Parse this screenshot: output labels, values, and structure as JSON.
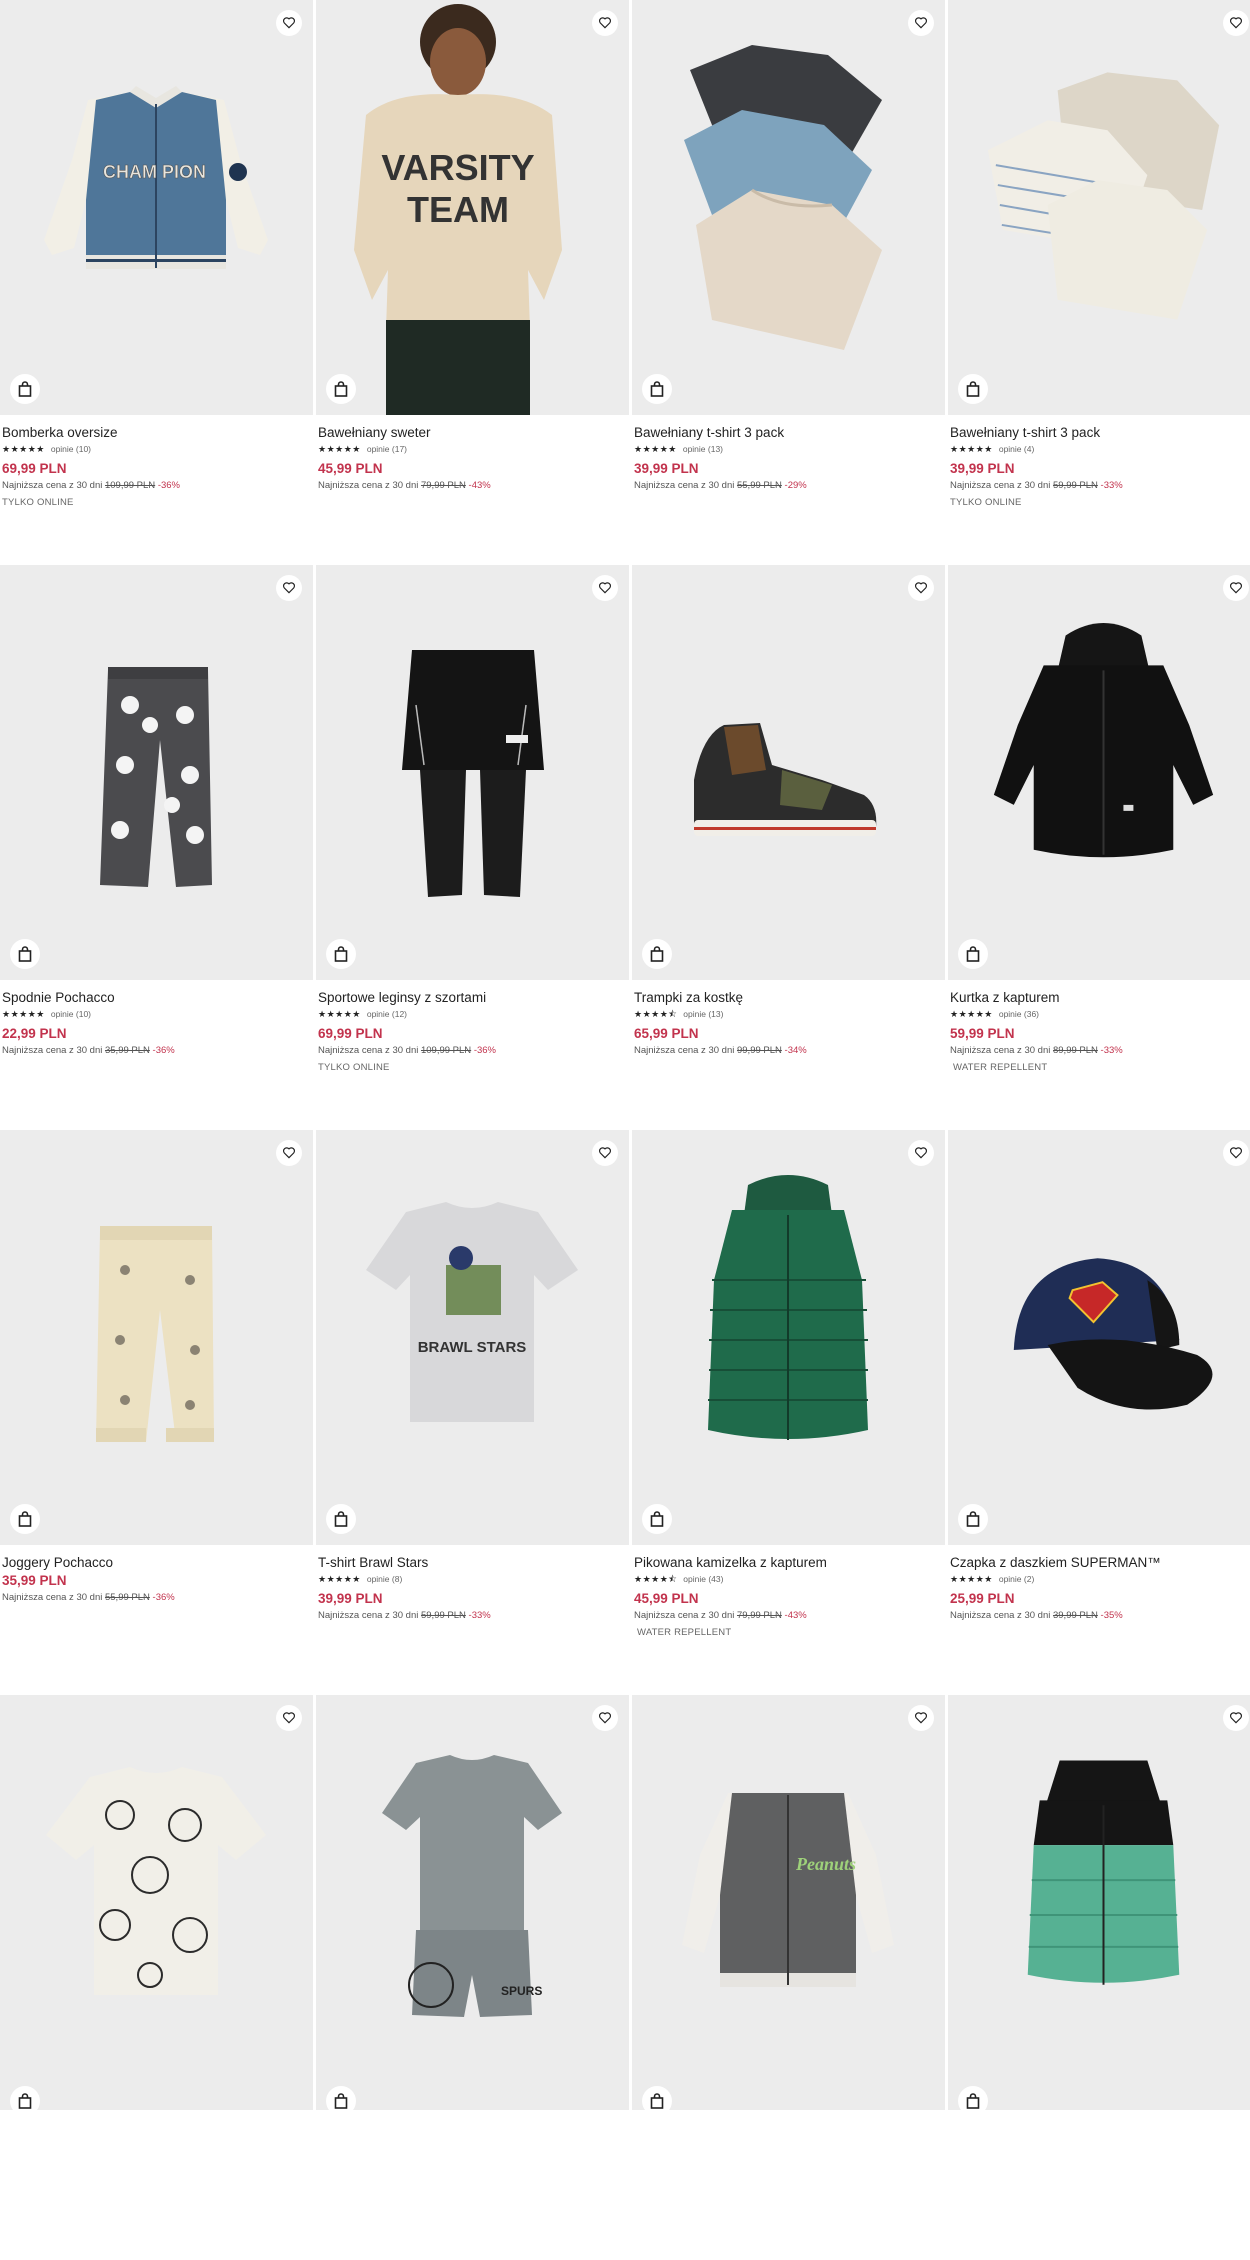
{
  "labels": {
    "wishlist": "♡",
    "cart": "bag"
  },
  "products": [
    {
      "name": "Bomberka oversize",
      "stars": "★★★★★",
      "reviews": "opinie (10)",
      "price": "69,99 PLN",
      "lowest_label": "Najniższa cena z 30 dni",
      "old_price": "109,99 PLN",
      "discount": "-36%",
      "tag": "TYLKO ONLINE"
    },
    {
      "name": "Bawełniany sweter",
      "stars": "★★★★★",
      "reviews": "opinie (17)",
      "price": "45,99 PLN",
      "lowest_label": "Najniższa cena z 30 dni",
      "old_price": "79,99 PLN",
      "discount": "-43%",
      "tag": ""
    },
    {
      "name": "Bawełniany t-shirt 3 pack",
      "stars": "★★★★★",
      "reviews": "opinie (13)",
      "price": "39,99 PLN",
      "lowest_label": "Najniższa cena z 30 dni",
      "old_price": "55,99 PLN",
      "discount": "-29%",
      "tag": ""
    },
    {
      "name": "Bawełniany t-shirt 3 pack",
      "stars": "★★★★★",
      "reviews": "opinie (4)",
      "price": "39,99 PLN",
      "lowest_label": "Najniższa cena z 30 dni",
      "old_price": "59,99 PLN",
      "discount": "-33%",
      "tag": "TYLKO ONLINE"
    },
    {
      "name": "Spodnie Pochacco",
      "stars": "★★★★★",
      "reviews": "opinie (10)",
      "price": "22,99 PLN",
      "lowest_label": "Najniższa cena z 30 dni",
      "old_price": "35,99 PLN",
      "discount": "-36%",
      "tag": ""
    },
    {
      "name": "Sportowe leginsy z szortami",
      "stars": "★★★★★",
      "reviews": "opinie (12)",
      "price": "69,99 PLN",
      "lowest_label": "Najniższa cena z 30 dni",
      "old_price": "109,99 PLN",
      "discount": "-36%",
      "tag": "TYLKO ONLINE"
    },
    {
      "name": "Trampki za kostkę",
      "stars": "★★★★⯪",
      "reviews": "opinie (13)",
      "price": "65,99 PLN",
      "lowest_label": "Najniższa cena z 30 dni",
      "old_price": "99,99 PLN",
      "discount": "-34%",
      "tag": ""
    },
    {
      "name": "Kurtka z kapturem",
      "stars": "★★★★★",
      "reviews": "opinie (36)",
      "price": "59,99 PLN",
      "lowest_label": "Najniższa cena z 30 dni",
      "old_price": "89,99 PLN",
      "discount": "-33%",
      "tag": "WATER REPELLENT"
    },
    {
      "name": "Joggery Pochacco",
      "stars": "",
      "reviews": "",
      "price": "35,99 PLN",
      "lowest_label": "Najniższa cena z 30 dni",
      "old_price": "55,99 PLN",
      "discount": "-36%",
      "tag": ""
    },
    {
      "name": "T-shirt Brawl Stars",
      "stars": "★★★★★",
      "reviews": "opinie (8)",
      "price": "39,99 PLN",
      "lowest_label": "Najniższa cena z 30 dni",
      "old_price": "59,99 PLN",
      "discount": "-33%",
      "tag": ""
    },
    {
      "name": "Pikowana kamizelka z kapturem",
      "stars": "★★★★⯪",
      "reviews": "opinie (43)",
      "price": "45,99 PLN",
      "lowest_label": "Najniższa cena z 30 dni",
      "old_price": "79,99 PLN",
      "discount": "-43%",
      "tag": "WATER REPELLENT"
    },
    {
      "name": "Czapka z daszkiem SUPERMAN™",
      "stars": "★★★★★",
      "reviews": "opinie (2)",
      "price": "25,99 PLN",
      "lowest_label": "Najniższa cena z 30 dni",
      "old_price": "39,99 PLN",
      "discount": "-35%",
      "tag": ""
    },
    {
      "name": "",
      "stars": "",
      "reviews": "",
      "price": "",
      "lowest_label": "",
      "old_price": "",
      "discount": "",
      "tag": ""
    },
    {
      "name": "",
      "stars": "",
      "reviews": "",
      "price": "",
      "lowest_label": "",
      "old_price": "",
      "discount": "",
      "tag": ""
    },
    {
      "name": "",
      "stars": "",
      "reviews": "",
      "price": "",
      "lowest_label": "",
      "old_price": "",
      "discount": "",
      "tag": ""
    },
    {
      "name": "",
      "stars": "",
      "reviews": "",
      "price": "",
      "lowest_label": "",
      "old_price": "",
      "discount": "",
      "tag": ""
    }
  ],
  "image_texts": {
    "champion": "CHAM  PION",
    "varsity": "VARSITY",
    "team": "TEAM",
    "brawl": "BRAWL STARS",
    "spurs": "SPURS",
    "peanuts": "Peanuts"
  },
  "colors": {
    "price": "#c2334d",
    "image_bg": "#ececec"
  }
}
